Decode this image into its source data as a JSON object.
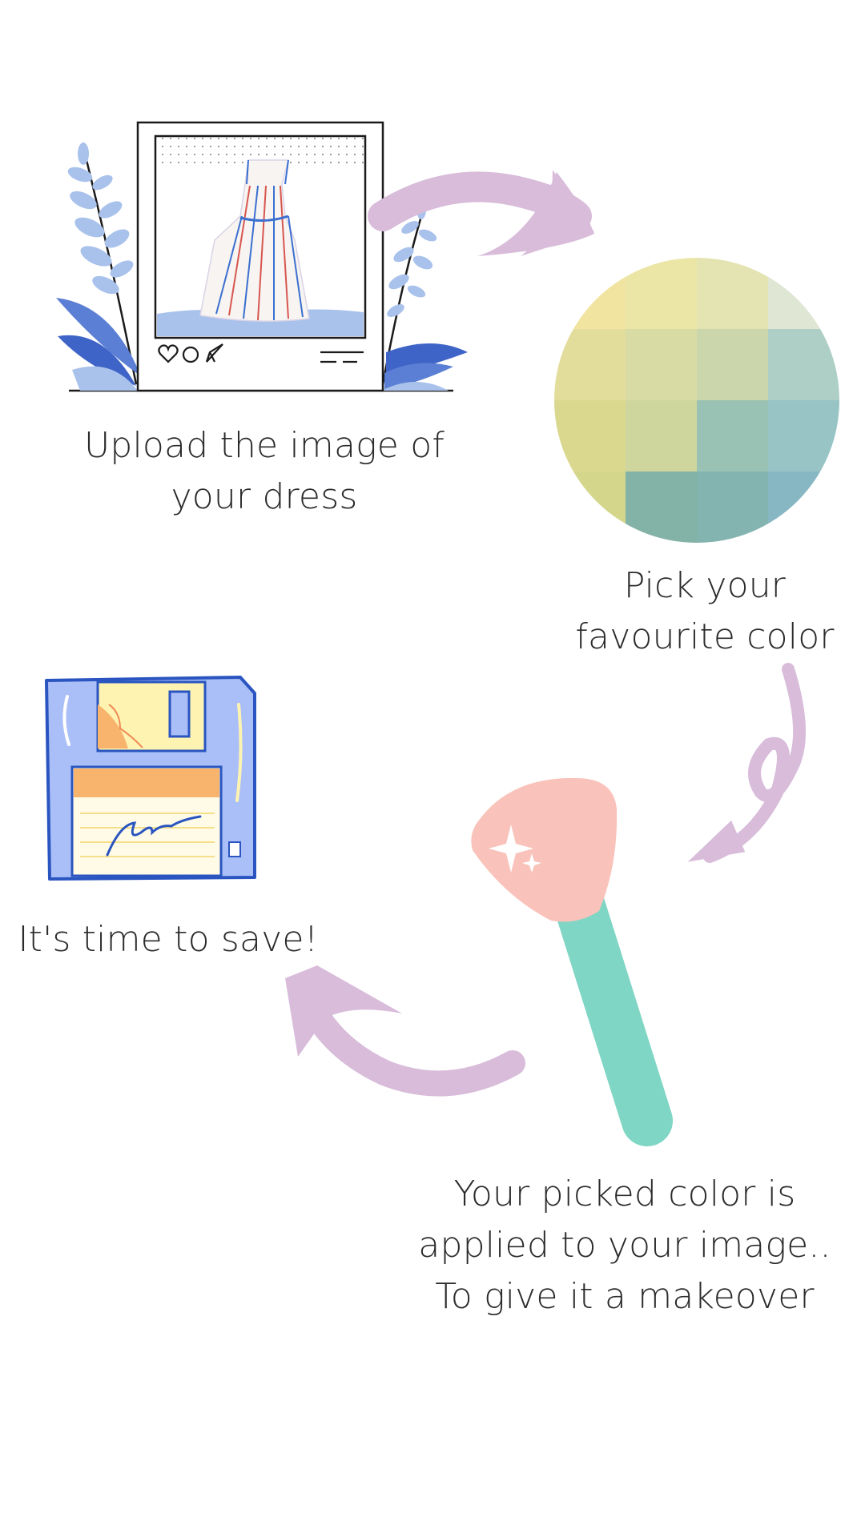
{
  "steps": [
    {
      "id": "upload",
      "lines": [
        "Upload the image of",
        "your dress"
      ],
      "icon": "instagram-post-dress-icon"
    },
    {
      "id": "pick",
      "lines": [
        "Pick your",
        "favourite color"
      ],
      "icon": "color-palette-circle-icon"
    },
    {
      "id": "apply",
      "lines": [
        "Your picked color is",
        "applied to your image..",
        "To give it a makeover"
      ],
      "icon": "makeup-brush-icon"
    },
    {
      "id": "save",
      "lines": [
        "It's time to save!"
      ],
      "icon": "floppy-disk-icon"
    }
  ],
  "colors": {
    "arrow": "#d8bcda",
    "text": "#2b2b2b",
    "brush_head": "#f9c3bb",
    "brush_handle": "#80d6c4",
    "floppy_body": "#aabff7",
    "floppy_label": "#fef3b1",
    "floppy_stripe": "#f8b46d",
    "outline_blue": "#2a55c0",
    "leaf_blue": "#a9c2ec"
  },
  "palette_grid": [
    [
      "#f1e3a0",
      "#ebe6a6",
      "#e4e4b2",
      "#dfe6d3"
    ],
    [
      "#e3dd9c",
      "#d8dba3",
      "#cbd6ad",
      "#aecfc6"
    ],
    [
      "#dad88f",
      "#cfd69d",
      "#99c2b4",
      "#98c4c5"
    ],
    [
      "#d4d68c",
      "#83b2a6",
      "#83b4b0",
      "#86b7c3"
    ]
  ]
}
